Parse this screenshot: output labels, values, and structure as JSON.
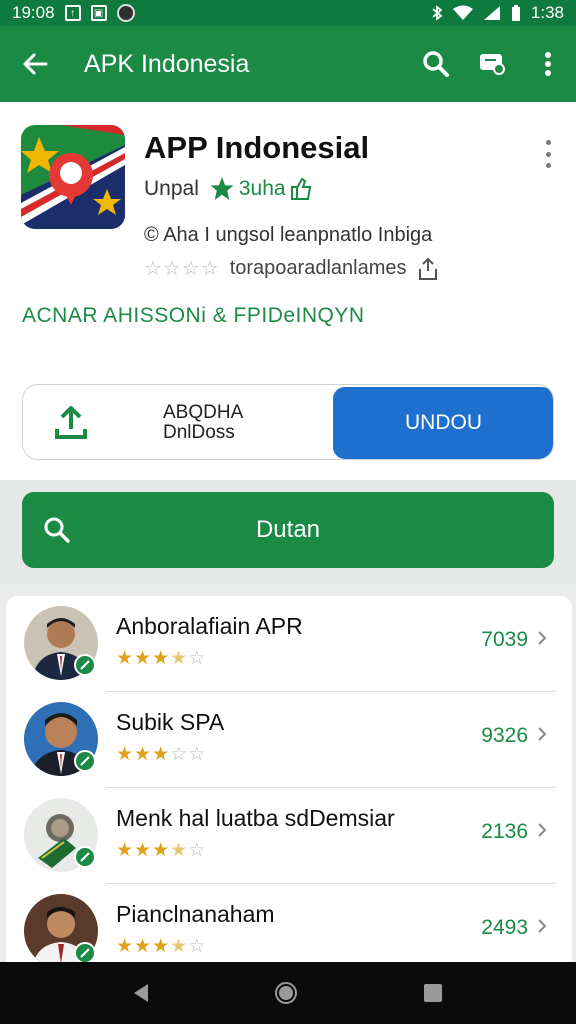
{
  "status_bar": {
    "time_left": "19:08",
    "time_right": "1:38",
    "left_icons": [
      "upload-notification-icon",
      "image-notification-icon",
      "app-notification-icon"
    ],
    "right_icons": [
      "bluetooth-icon",
      "wifi-icon",
      "signal-icon",
      "battery-icon"
    ]
  },
  "app_bar": {
    "title": "APK Indonesia",
    "icons": [
      "back-arrow-icon",
      "search-icon",
      "cast-icon",
      "more-vert-icon"
    ]
  },
  "app": {
    "name": "APP Indonesial",
    "developer": "Unpal",
    "rating_label": "3uha",
    "description": "© Aha I ungsol leanpnatlo Inbiga",
    "rating_text": "torapoaradlanlames",
    "cta": "ACNAR AHISSONi & FPIDeINQYN"
  },
  "actions": {
    "share_line1": "ABQDHA",
    "share_line2": "DnlDoss",
    "download": "UNDOU",
    "search": "Dutan"
  },
  "list": [
    {
      "name": "Anboralafiain APR",
      "count": "7039",
      "rating": 3.5
    },
    {
      "name": "Subik SPA",
      "count": "9326",
      "rating": 3
    },
    {
      "name": "Menk hal luatba sdDemsiar",
      "count": "2136",
      "rating": 3.5
    },
    {
      "name": "Pianclnanaham",
      "count": "2493",
      "rating": 3.5
    }
  ],
  "colors": {
    "primary_green": "#1a8a45",
    "status_green": "#0f7a3d",
    "download_blue": "#1f6fcf",
    "star_gold": "#e0a21c"
  }
}
